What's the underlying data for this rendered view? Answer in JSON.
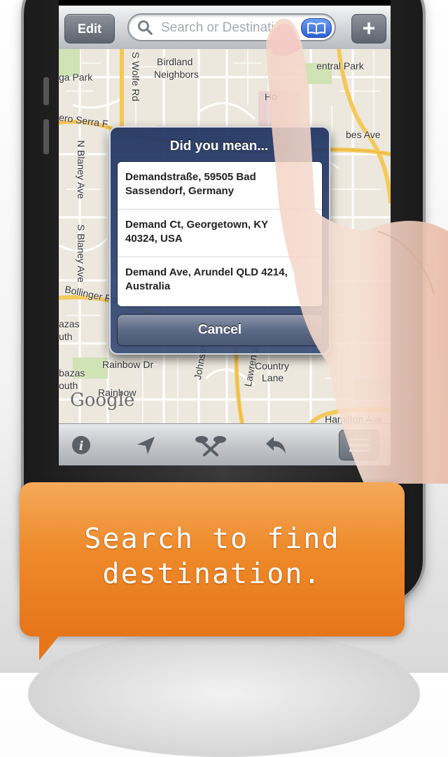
{
  "navbar": {
    "edit_label": "Edit",
    "search_placeholder": "Search or Destination",
    "add_label": "+"
  },
  "map": {
    "labels": [
      {
        "text": "Birdland"
      },
      {
        "text": "Neighbors"
      },
      {
        "text": "ga Park"
      },
      {
        "text": "S Wolfe Rd"
      },
      {
        "text": "entral Park"
      },
      {
        "text": "ero Serra F"
      },
      {
        "text": "N Blaney Ave"
      },
      {
        "text": "S Blaney Ave"
      },
      {
        "text": "Bollinger Rd"
      },
      {
        "text": "bes Ave"
      },
      {
        "text": "azas"
      },
      {
        "text": "uth"
      },
      {
        "text": "Rainbow Dr"
      },
      {
        "text": "bazas"
      },
      {
        "text": "outh"
      },
      {
        "text": "Rainbow"
      },
      {
        "text": "Johnson"
      },
      {
        "text": "Lawrence"
      },
      {
        "text": "Country"
      },
      {
        "text": "Lane"
      },
      {
        "text": "Hamilton Ave"
      },
      {
        "text": "Ho"
      }
    ],
    "attribution": "Google"
  },
  "dialog": {
    "title": "Did you mean...",
    "options": [
      {
        "line1": "Demandstraße, 59505 Bad",
        "line2": "Sassendorf, Germany"
      },
      {
        "line1": "Demand Ct, Georgetown, KY",
        "line2": "40324, USA"
      },
      {
        "line1": "Demand Ave, Arundel QLD 4214,",
        "line2": "Australia"
      }
    ],
    "cancel_label": "Cancel"
  },
  "toolbar": {
    "icons": [
      "info-icon",
      "location-arrow-icon",
      "route-icon",
      "back-arrow-icon",
      "list-icon"
    ]
  },
  "caption": {
    "line1": "Search to find",
    "line2": "destination."
  },
  "colors": {
    "caption_orange": "#ee8a2a",
    "dialog_blue": "#2d4373",
    "search_button_blue": "#2d5ed3"
  }
}
